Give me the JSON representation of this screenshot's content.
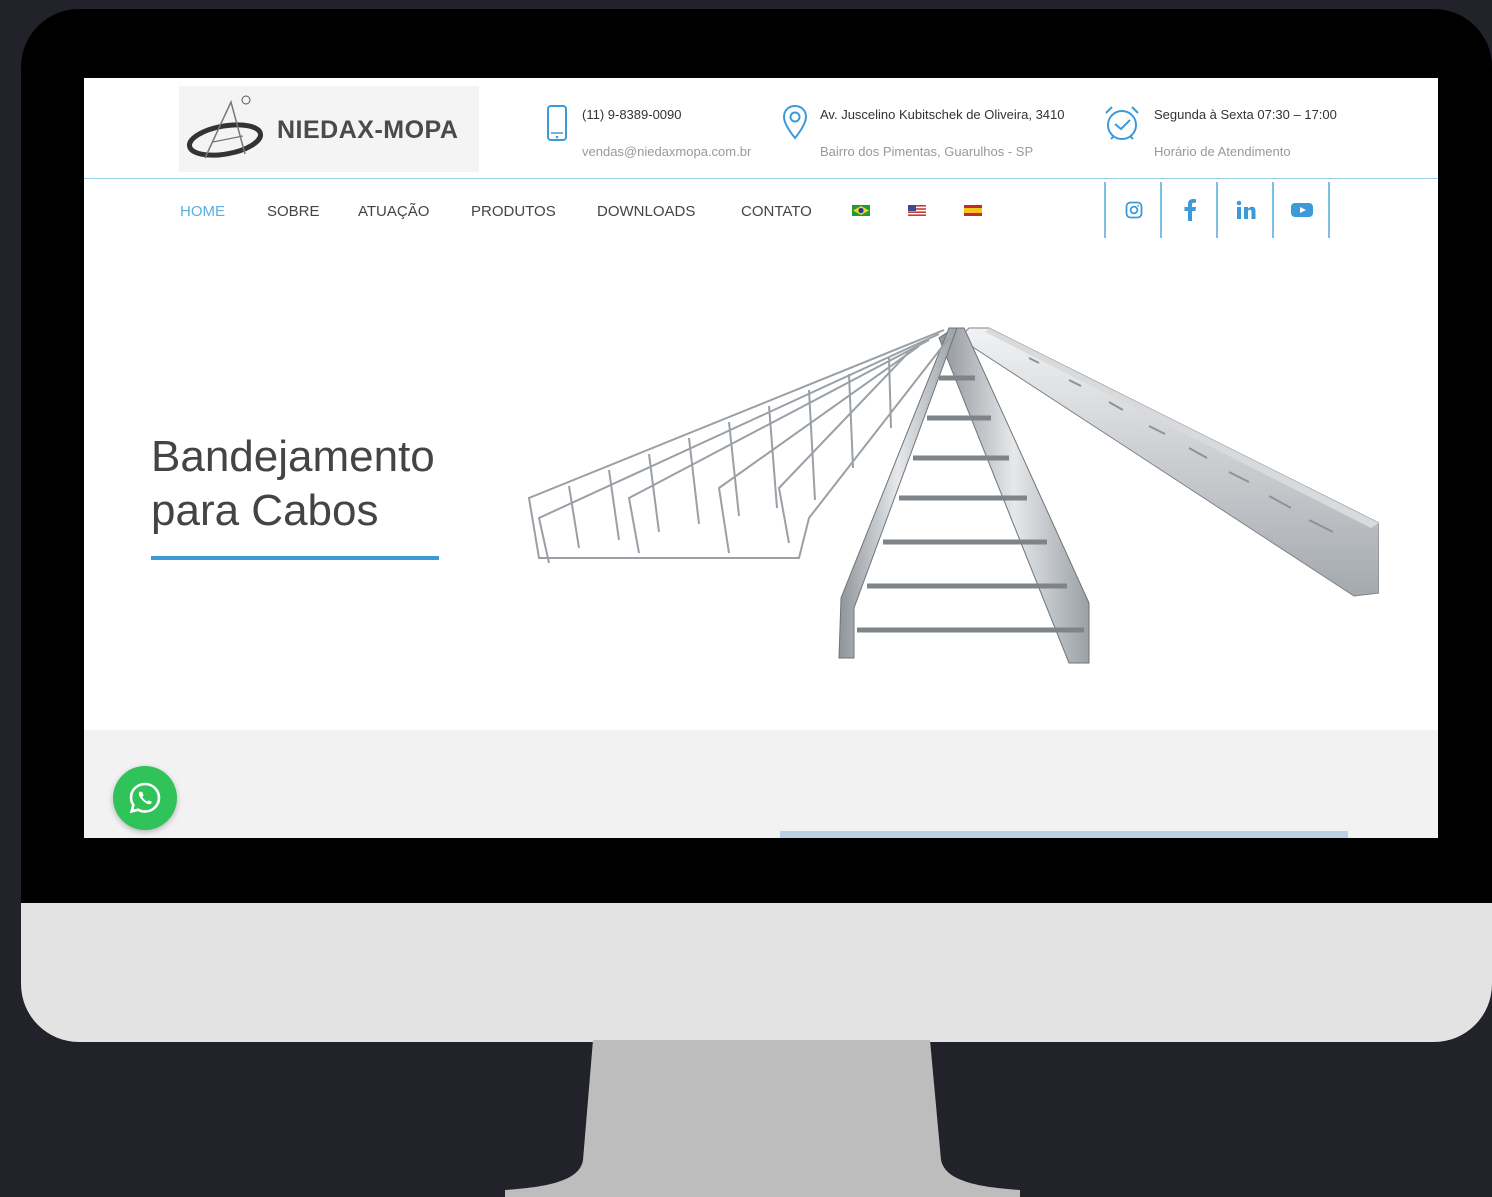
{
  "brand": {
    "name": "NIEDAX-MOPA"
  },
  "contact": {
    "phone": "(11) 9-8389-0090",
    "email": "vendas@niedaxmopa.com.br",
    "address_line1": "Av. Juscelino Kubitschek de Oliveira, 3410",
    "address_line2": "Bairro dos Pimentas, Guarulhos - SP",
    "hours_line1": "Segunda à Sexta 07:30 – 17:00",
    "hours_line2": "Horário de Atendimento"
  },
  "nav": {
    "items": [
      "HOME",
      "SOBRE",
      "ATUAÇÃO",
      "PRODUTOS",
      "DOWNLOADS",
      "CONTATO"
    ],
    "active": "HOME",
    "languages": [
      "pt-BR",
      "en-US",
      "es"
    ]
  },
  "social": [
    "instagram-icon",
    "facebook-icon",
    "linkedin-icon",
    "youtube-icon"
  ],
  "hero": {
    "title_line1": "Bandejamento",
    "title_line2": "para Cabos"
  },
  "colors": {
    "accent": "#5aaee3",
    "rule": "#3d9ad8",
    "whatsapp": "#2fc35a"
  }
}
